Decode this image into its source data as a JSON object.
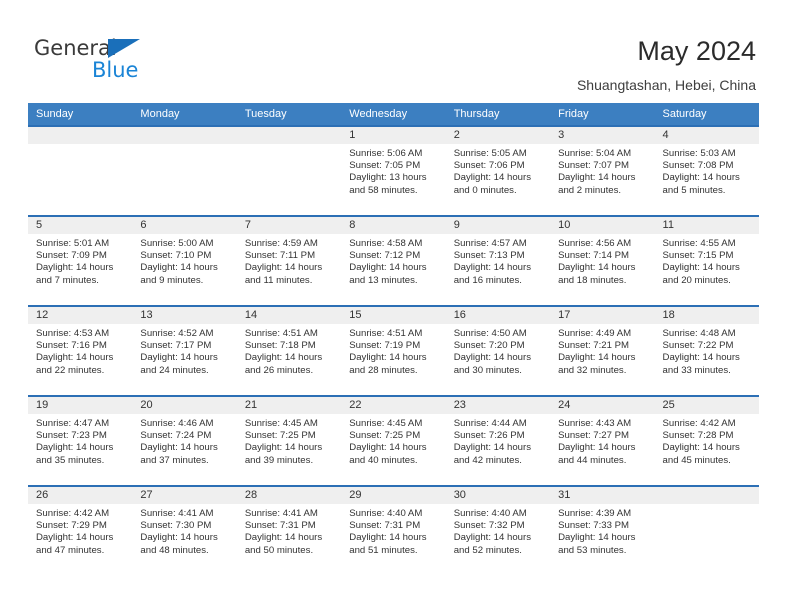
{
  "brand": {
    "name_part1": "General",
    "name_part2": "Blue",
    "triangle_icon": "blue-triangle-logo-mark"
  },
  "header": {
    "title": "May 2024",
    "subtitle": "Shuangtashan, Hebei, China"
  },
  "colors": {
    "header_bar": "#3c7fc1",
    "row_divider": "#2c6fb5",
    "date_band": "#efefef",
    "brand_blue": "#1a84d6",
    "text": "#333333"
  },
  "weekdays": [
    "Sunday",
    "Monday",
    "Tuesday",
    "Wednesday",
    "Thursday",
    "Friday",
    "Saturday"
  ],
  "labels": {
    "sunrise_prefix": "Sunrise:",
    "sunset_prefix": "Sunset:",
    "daylight_prefix": "Daylight:"
  },
  "weeks": [
    [
      {
        "day": "",
        "empty": true
      },
      {
        "day": "",
        "empty": true
      },
      {
        "day": "",
        "empty": true
      },
      {
        "day": "1",
        "sunrise": "Sunrise: 5:06 AM",
        "sunset": "Sunset: 7:05 PM",
        "daylight_line1": "Daylight: 13 hours",
        "daylight_line2": "and 58 minutes."
      },
      {
        "day": "2",
        "sunrise": "Sunrise: 5:05 AM",
        "sunset": "Sunset: 7:06 PM",
        "daylight_line1": "Daylight: 14 hours",
        "daylight_line2": "and 0 minutes."
      },
      {
        "day": "3",
        "sunrise": "Sunrise: 5:04 AM",
        "sunset": "Sunset: 7:07 PM",
        "daylight_line1": "Daylight: 14 hours",
        "daylight_line2": "and 2 minutes."
      },
      {
        "day": "4",
        "sunrise": "Sunrise: 5:03 AM",
        "sunset": "Sunset: 7:08 PM",
        "daylight_line1": "Daylight: 14 hours",
        "daylight_line2": "and 5 minutes."
      }
    ],
    [
      {
        "day": "5",
        "sunrise": "Sunrise: 5:01 AM",
        "sunset": "Sunset: 7:09 PM",
        "daylight_line1": "Daylight: 14 hours",
        "daylight_line2": "and 7 minutes."
      },
      {
        "day": "6",
        "sunrise": "Sunrise: 5:00 AM",
        "sunset": "Sunset: 7:10 PM",
        "daylight_line1": "Daylight: 14 hours",
        "daylight_line2": "and 9 minutes."
      },
      {
        "day": "7",
        "sunrise": "Sunrise: 4:59 AM",
        "sunset": "Sunset: 7:11 PM",
        "daylight_line1": "Daylight: 14 hours",
        "daylight_line2": "and 11 minutes."
      },
      {
        "day": "8",
        "sunrise": "Sunrise: 4:58 AM",
        "sunset": "Sunset: 7:12 PM",
        "daylight_line1": "Daylight: 14 hours",
        "daylight_line2": "and 13 minutes."
      },
      {
        "day": "9",
        "sunrise": "Sunrise: 4:57 AM",
        "sunset": "Sunset: 7:13 PM",
        "daylight_line1": "Daylight: 14 hours",
        "daylight_line2": "and 16 minutes."
      },
      {
        "day": "10",
        "sunrise": "Sunrise: 4:56 AM",
        "sunset": "Sunset: 7:14 PM",
        "daylight_line1": "Daylight: 14 hours",
        "daylight_line2": "and 18 minutes."
      },
      {
        "day": "11",
        "sunrise": "Sunrise: 4:55 AM",
        "sunset": "Sunset: 7:15 PM",
        "daylight_line1": "Daylight: 14 hours",
        "daylight_line2": "and 20 minutes."
      }
    ],
    [
      {
        "day": "12",
        "sunrise": "Sunrise: 4:53 AM",
        "sunset": "Sunset: 7:16 PM",
        "daylight_line1": "Daylight: 14 hours",
        "daylight_line2": "and 22 minutes."
      },
      {
        "day": "13",
        "sunrise": "Sunrise: 4:52 AM",
        "sunset": "Sunset: 7:17 PM",
        "daylight_line1": "Daylight: 14 hours",
        "daylight_line2": "and 24 minutes."
      },
      {
        "day": "14",
        "sunrise": "Sunrise: 4:51 AM",
        "sunset": "Sunset: 7:18 PM",
        "daylight_line1": "Daylight: 14 hours",
        "daylight_line2": "and 26 minutes."
      },
      {
        "day": "15",
        "sunrise": "Sunrise: 4:51 AM",
        "sunset": "Sunset: 7:19 PM",
        "daylight_line1": "Daylight: 14 hours",
        "daylight_line2": "and 28 minutes."
      },
      {
        "day": "16",
        "sunrise": "Sunrise: 4:50 AM",
        "sunset": "Sunset: 7:20 PM",
        "daylight_line1": "Daylight: 14 hours",
        "daylight_line2": "and 30 minutes."
      },
      {
        "day": "17",
        "sunrise": "Sunrise: 4:49 AM",
        "sunset": "Sunset: 7:21 PM",
        "daylight_line1": "Daylight: 14 hours",
        "daylight_line2": "and 32 minutes."
      },
      {
        "day": "18",
        "sunrise": "Sunrise: 4:48 AM",
        "sunset": "Sunset: 7:22 PM",
        "daylight_line1": "Daylight: 14 hours",
        "daylight_line2": "and 33 minutes."
      }
    ],
    [
      {
        "day": "19",
        "sunrise": "Sunrise: 4:47 AM",
        "sunset": "Sunset: 7:23 PM",
        "daylight_line1": "Daylight: 14 hours",
        "daylight_line2": "and 35 minutes."
      },
      {
        "day": "20",
        "sunrise": "Sunrise: 4:46 AM",
        "sunset": "Sunset: 7:24 PM",
        "daylight_line1": "Daylight: 14 hours",
        "daylight_line2": "and 37 minutes."
      },
      {
        "day": "21",
        "sunrise": "Sunrise: 4:45 AM",
        "sunset": "Sunset: 7:25 PM",
        "daylight_line1": "Daylight: 14 hours",
        "daylight_line2": "and 39 minutes."
      },
      {
        "day": "22",
        "sunrise": "Sunrise: 4:45 AM",
        "sunset": "Sunset: 7:25 PM",
        "daylight_line1": "Daylight: 14 hours",
        "daylight_line2": "and 40 minutes."
      },
      {
        "day": "23",
        "sunrise": "Sunrise: 4:44 AM",
        "sunset": "Sunset: 7:26 PM",
        "daylight_line1": "Daylight: 14 hours",
        "daylight_line2": "and 42 minutes."
      },
      {
        "day": "24",
        "sunrise": "Sunrise: 4:43 AM",
        "sunset": "Sunset: 7:27 PM",
        "daylight_line1": "Daylight: 14 hours",
        "daylight_line2": "and 44 minutes."
      },
      {
        "day": "25",
        "sunrise": "Sunrise: 4:42 AM",
        "sunset": "Sunset: 7:28 PM",
        "daylight_line1": "Daylight: 14 hours",
        "daylight_line2": "and 45 minutes."
      }
    ],
    [
      {
        "day": "26",
        "sunrise": "Sunrise: 4:42 AM",
        "sunset": "Sunset: 7:29 PM",
        "daylight_line1": "Daylight: 14 hours",
        "daylight_line2": "and 47 minutes."
      },
      {
        "day": "27",
        "sunrise": "Sunrise: 4:41 AM",
        "sunset": "Sunset: 7:30 PM",
        "daylight_line1": "Daylight: 14 hours",
        "daylight_line2": "and 48 minutes."
      },
      {
        "day": "28",
        "sunrise": "Sunrise: 4:41 AM",
        "sunset": "Sunset: 7:31 PM",
        "daylight_line1": "Daylight: 14 hours",
        "daylight_line2": "and 50 minutes."
      },
      {
        "day": "29",
        "sunrise": "Sunrise: 4:40 AM",
        "sunset": "Sunset: 7:31 PM",
        "daylight_line1": "Daylight: 14 hours",
        "daylight_line2": "and 51 minutes."
      },
      {
        "day": "30",
        "sunrise": "Sunrise: 4:40 AM",
        "sunset": "Sunset: 7:32 PM",
        "daylight_line1": "Daylight: 14 hours",
        "daylight_line2": "and 52 minutes."
      },
      {
        "day": "31",
        "sunrise": "Sunrise: 4:39 AM",
        "sunset": "Sunset: 7:33 PM",
        "daylight_line1": "Daylight: 14 hours",
        "daylight_line2": "and 53 minutes."
      },
      {
        "day": "",
        "empty": true
      }
    ]
  ]
}
